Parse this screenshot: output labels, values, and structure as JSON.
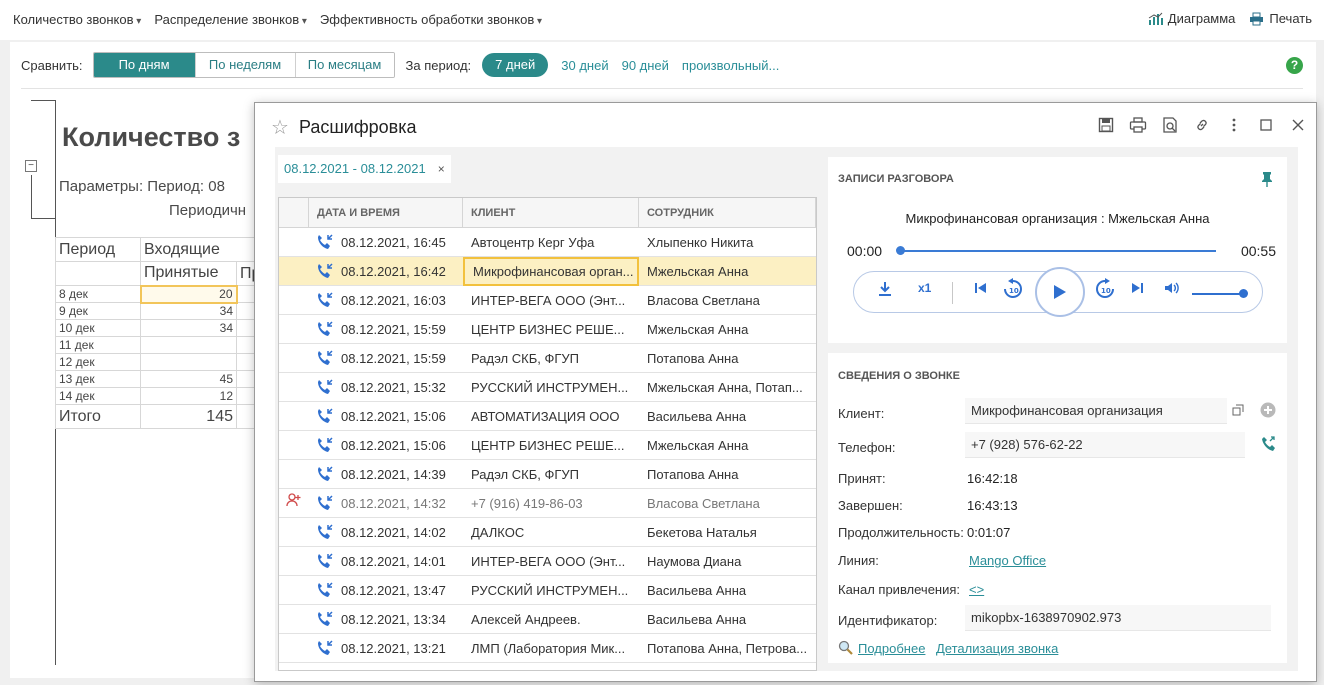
{
  "topmenu": {
    "items": [
      "Количество звонков",
      "Распределение звонков",
      "Эффективность обработки звонков"
    ],
    "diagram": "Диаграмма",
    "print": "Печать"
  },
  "compare": {
    "label": "Сравнить:",
    "options": [
      "По дням",
      "По неделям",
      "По месяцам"
    ],
    "period_label": "За период:",
    "period_active": "7 дней",
    "period_links": [
      "30 дней",
      "90 дней",
      "произвольный..."
    ],
    "help": "?"
  },
  "report": {
    "title": "Количество з",
    "params": "Параметры:   Период: 08",
    "params2": "Периодичн",
    "head1": [
      "Период",
      "Входящие"
    ],
    "head2": [
      "",
      "Принятые",
      "Пр"
    ],
    "rows": [
      {
        "d": "8 дек",
        "v": "20"
      },
      {
        "d": "9 дек",
        "v": "34"
      },
      {
        "d": "10 дек",
        "v": "34"
      },
      {
        "d": "11 дек",
        "v": ""
      },
      {
        "d": "12 дек",
        "v": ""
      },
      {
        "d": "13 дек",
        "v": "45"
      },
      {
        "d": "14 дек",
        "v": "12"
      }
    ],
    "total_label": "Итого",
    "total": "145",
    "collapse": "−"
  },
  "modal": {
    "title": "Расшифровка",
    "star": "☆",
    "filter_chip": "08.12.2021 - 08.12.2021",
    "chip_close": "×",
    "columns": [
      "ДАТА И ВРЕМЯ",
      "КЛИЕНТ",
      "СОТРУДНИК"
    ],
    "rows": [
      {
        "dt": "08.12.2021, 16:45",
        "client": "Автоцентр Керг Уфа",
        "emp": "Хлыпенко Никита"
      },
      {
        "dt": "08.12.2021, 16:42",
        "client": "Микрофинансовая орган...",
        "emp": "Мжельская Анна"
      },
      {
        "dt": "08.12.2021, 16:03",
        "client": "ИНТЕР-ВЕГА ООО (Энт...",
        "emp": "Власова Светлана"
      },
      {
        "dt": "08.12.2021, 15:59",
        "client": "ЦЕНТР БИЗНЕС РЕШЕ...",
        "emp": "Мжельская Анна"
      },
      {
        "dt": "08.12.2021, 15:59",
        "client": "Радэл СКБ, ФГУП",
        "emp": "Потапова Анна"
      },
      {
        "dt": "08.12.2021, 15:32",
        "client": "РУССКИЙ ИНСТРУМЕН...",
        "emp": "Мжельская Анна, Потап..."
      },
      {
        "dt": "08.12.2021, 15:06",
        "client": "АВТОМАТИЗАЦИЯ ООО",
        "emp": "Васильева Анна"
      },
      {
        "dt": "08.12.2021, 15:06",
        "client": "ЦЕНТР БИЗНЕС РЕШЕ...",
        "emp": "Мжельская Анна"
      },
      {
        "dt": "08.12.2021, 14:39",
        "client": "Радэл СКБ, ФГУП",
        "emp": "Потапова Анна"
      },
      {
        "dt": "08.12.2021, 14:32",
        "client": "+7 (916) 419-86-03",
        "emp": "Власова Светлана"
      },
      {
        "dt": "08.12.2021, 14:02",
        "client": "ДАЛКОС",
        "emp": "Бекетова Наталья"
      },
      {
        "dt": "08.12.2021, 14:01",
        "client": "ИНТЕР-ВЕГА ООО (Энт...",
        "emp": "Наумова Диана"
      },
      {
        "dt": "08.12.2021, 13:47",
        "client": "РУССКИЙ ИНСТРУМЕН...",
        "emp": "Васильева Анна"
      },
      {
        "dt": "08.12.2021, 13:34",
        "client": "Алексей Андреев.",
        "emp": "Васильева Анна"
      },
      {
        "dt": "08.12.2021, 13:21",
        "client": "ЛМП (Лаборатория Мик...",
        "emp": "Потапова Анна, Петрова..."
      }
    ],
    "recording": {
      "header": "ЗАПИСИ РАЗГОВОРА",
      "name": "Микрофинансовая организация : Мжельская Анна",
      "time_start": "00:00",
      "time_end": "00:55",
      "progress": 0,
      "speed": "x1",
      "volume": 1.0
    },
    "info": {
      "header": "СВЕДЕНИЯ О ЗВОНКЕ",
      "client_label": "Клиент:",
      "client": "Микрофинансовая организация",
      "phone_label": "Телефон:",
      "phone": "+7 (928) 576-62-22",
      "accepted_label": "Принят:",
      "accepted": "16:42:18",
      "finished_label": "Завершен:",
      "finished": "16:43:13",
      "duration_label": "Продолжительность:",
      "duration": "0:01:07",
      "line_label": "Линия:",
      "line": "Mango Office",
      "channel_label": "Канал привлечения:",
      "channel": "<>",
      "id_label": "Идентификатор:",
      "id": "mikopbx-1638970902.973",
      "more_link": "Подробнее",
      "detail_link": "Детализация звонка"
    }
  },
  "colors": {
    "accent": "#2b8a8a",
    "link": "#2a8e98",
    "blue": "#2f6fcf",
    "selected_row": "#fcf0c3",
    "green": "#37a54a"
  }
}
